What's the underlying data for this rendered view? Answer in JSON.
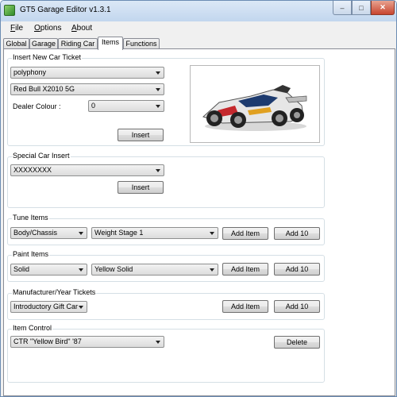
{
  "window": {
    "title": "GT5 Garage Editor v1.3.1",
    "controls": {
      "minimize": "–",
      "maximize": "□",
      "close": "✕"
    }
  },
  "menu": [
    {
      "label": "File",
      "accel": "F",
      "rest": "ile"
    },
    {
      "label": "Options",
      "accel": "O",
      "rest": "ptions"
    },
    {
      "label": "About",
      "accel": "A",
      "rest": "bout"
    }
  ],
  "tabs": [
    "Global",
    "Garage",
    "Riding Car",
    "Items",
    "Functions"
  ],
  "active_tab": "Items",
  "insert_new_car_ticket": {
    "label": "Insert New Car Ticket",
    "manufacturer": "polyphony",
    "car": "Red Bull X2010 5G",
    "dealer_colour_label": "Dealer Colour :",
    "dealer_colour": "0",
    "insert_button": "Insert"
  },
  "special_car_insert": {
    "label": "Special Car Insert",
    "car": "XXXXXXXX",
    "insert_button": "Insert"
  },
  "tune_items": {
    "label": "Tune Items",
    "category": "Body/Chassis",
    "item": "Weight Stage 1",
    "add_button": "Add Item",
    "add10_button": "Add 10"
  },
  "paint_items": {
    "label": "Paint Items",
    "type": "Solid",
    "color": "Yellow Solid",
    "add_button": "Add Item",
    "add10_button": "Add 10"
  },
  "manufacturer_year_tickets": {
    "label": "Manufacturer/Year Tickets",
    "ticket": "Introductory Gift Car",
    "add_button": "Add Item",
    "add10_button": "Add 10"
  },
  "item_control": {
    "label": "Item Control",
    "item": "CTR \"Yellow Bird\" '87",
    "delete_button": "Delete"
  },
  "colors": {
    "title_gradient_top": "#dbe8f6",
    "title_gradient_bottom": "#c2d6ee",
    "close_button": "#c7452f",
    "window_bg": "#f0f0f0",
    "tab_page_bg": "#ffffff"
  },
  "icons": {
    "app": "gt5-app-icon",
    "car_preview": "red-bull-x2010-car-image"
  }
}
